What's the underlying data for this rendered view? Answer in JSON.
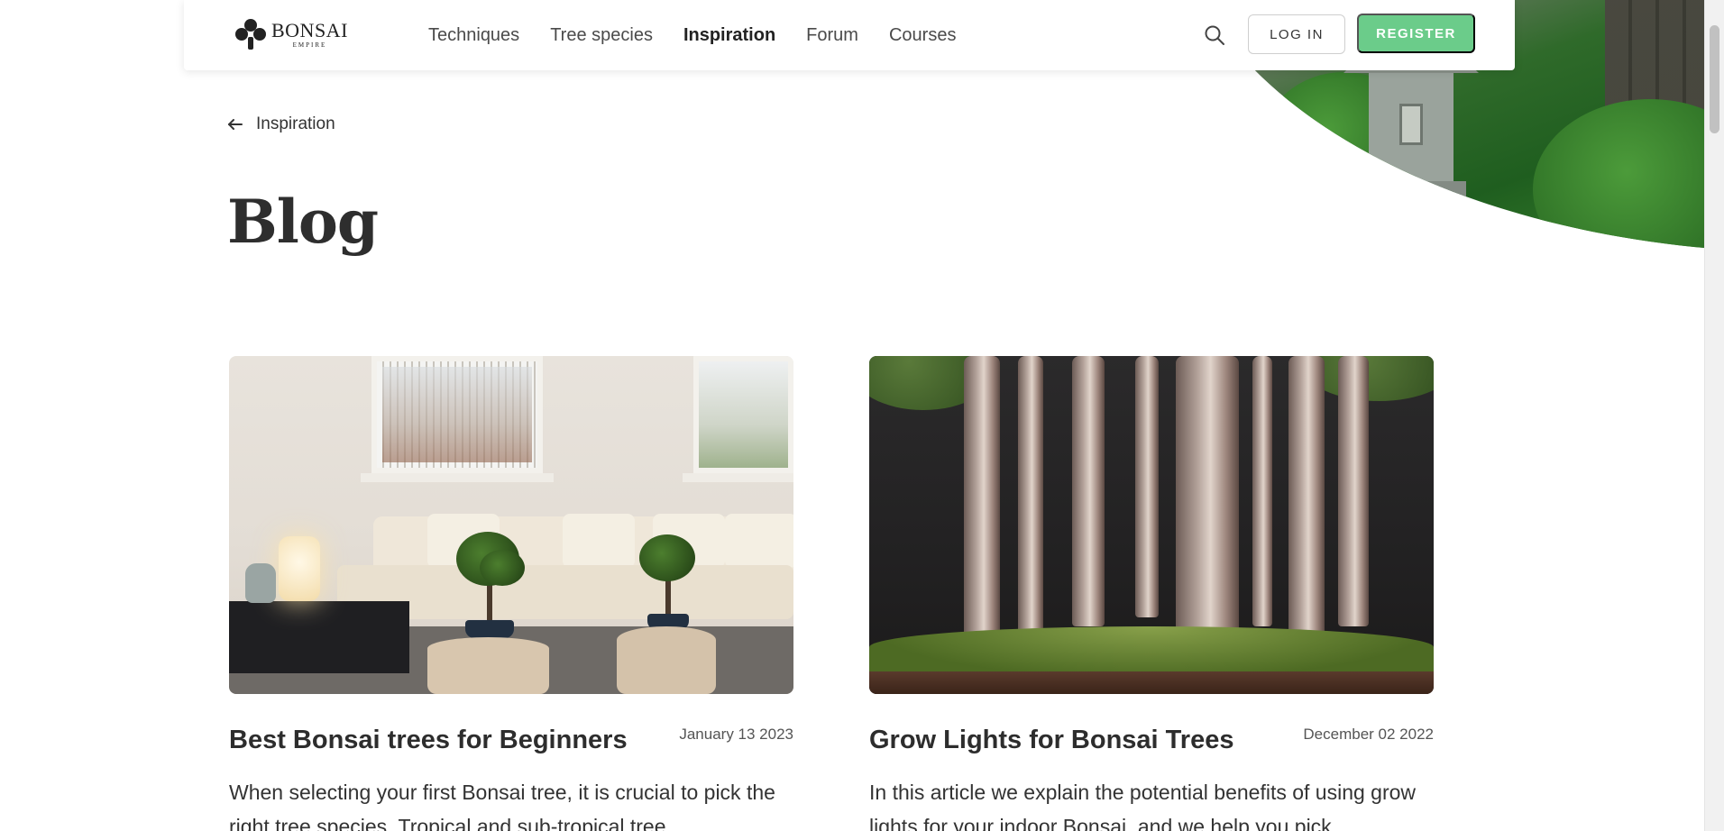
{
  "brand": {
    "name": "BONSAI",
    "subtitle": "EMPIRE"
  },
  "nav": {
    "items": [
      {
        "label": "Techniques",
        "active": false
      },
      {
        "label": "Tree species",
        "active": false
      },
      {
        "label": "Inspiration",
        "active": true
      },
      {
        "label": "Forum",
        "active": false
      },
      {
        "label": "Courses",
        "active": false
      }
    ],
    "login_label": "LOG IN",
    "register_label": "REGISTER"
  },
  "colors": {
    "accent": "#6bcc8a",
    "text": "#2f2f2f"
  },
  "back_link": {
    "label": "Inspiration"
  },
  "page": {
    "title": "Blog"
  },
  "posts": [
    {
      "title": "Best Bonsai trees for Beginners",
      "date": "January 13 2023",
      "excerpt": "When selecting your first Bonsai tree, it is crucial to pick the right tree species. Tropical and sub-tropical tree"
    },
    {
      "title": "Grow Lights for Bonsai Trees",
      "date": "December 02 2022",
      "excerpt": "In this article we explain the potential benefits of using grow lights for your indoor Bonsai, and we help you pick"
    }
  ]
}
